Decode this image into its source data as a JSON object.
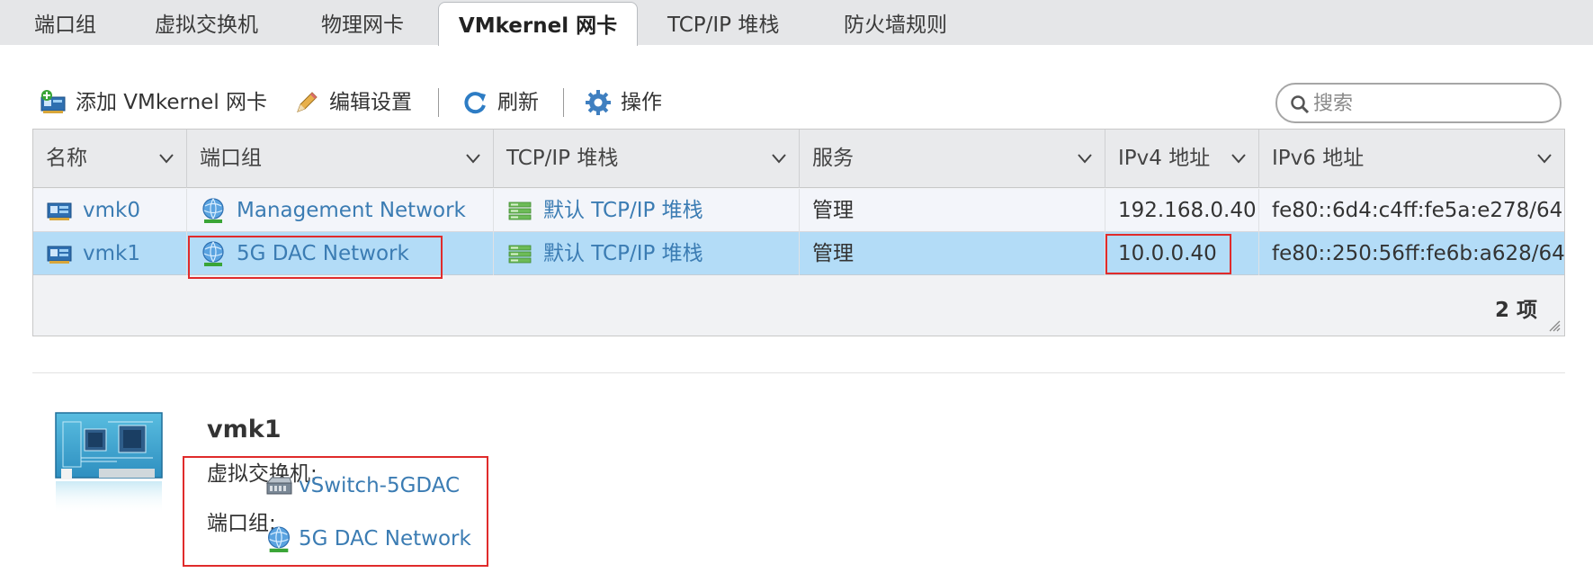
{
  "tabs": [
    {
      "label": "端口组",
      "active": false
    },
    {
      "label": "虚拟交换机",
      "active": false
    },
    {
      "label": "物理网卡",
      "active": false
    },
    {
      "label": "VMkernel 网卡",
      "active": true
    },
    {
      "label": "TCP/IP 堆栈",
      "active": false
    },
    {
      "label": "防火墙规则",
      "active": false
    }
  ],
  "toolbar": {
    "add_label": "添加 VMkernel 网卡",
    "edit_label": "编辑设置",
    "refresh_label": "刷新",
    "actions_label": "操作"
  },
  "search": {
    "placeholder": "搜索",
    "value": ""
  },
  "table": {
    "columns": [
      "名称",
      "端口组",
      "TCP/IP 堆栈",
      "服务",
      "IPv4 地址",
      "IPv6 地址"
    ],
    "rows": [
      {
        "name": "vmk0",
        "portgroup": "Management Network",
        "stack": "默认 TCP/IP 堆栈",
        "service": "管理",
        "ipv4": "192.168.0.40",
        "ipv6": "fe80::6d4:c4ff:fe5a:e278/64",
        "selected": false
      },
      {
        "name": "vmk1",
        "portgroup": "5G DAC Network",
        "stack": "默认 TCP/IP 堆栈",
        "service": "管理",
        "ipv4": "10.0.0.40",
        "ipv6": "fe80::250:56ff:fe6b:a628/64",
        "selected": true
      }
    ],
    "count_label": "2 项"
  },
  "detail": {
    "title": "vmk1",
    "vswitch_label": "虚拟交换机:",
    "vswitch_value": "vSwitch-5GDAC",
    "portgroup_label": "端口组:",
    "portgroup_value": "5G DAC Network"
  },
  "colors": {
    "link": "#3b7cb3",
    "selected_row": "#b3dcf7",
    "highlight": "#e02b2b",
    "tabbar": "#e5e6e8"
  }
}
